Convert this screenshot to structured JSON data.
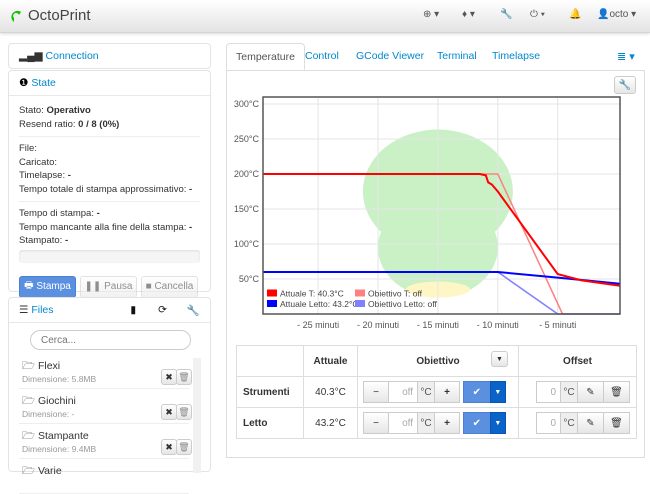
{
  "navbar": {
    "brand": "OctoPrint",
    "user": "octo"
  },
  "connection": {
    "title": "Connection"
  },
  "state": {
    "title": "State",
    "stato_label": "Stato:",
    "stato_value": "Operativo",
    "resend_label": "Resend ratio:",
    "resend_value": "0 / 8 (0%)",
    "file_label": "File:",
    "caricato_label": "Caricato:",
    "timelapse_label": "Timelapse:",
    "timelapse_value": "-",
    "tempo_totale_label": "Tempo totale di stampa approssimativo:",
    "tempo_totale_value": "-",
    "tempo_stampa_label": "Tempo di stampa:",
    "tempo_stampa_value": "-",
    "tempo_mancante_label": "Tempo mancante alla fine della stampa:",
    "tempo_mancante_value": "-",
    "stampato_label": "Stampato:",
    "stampato_value": "-",
    "progress": 0,
    "stampa_button": "Stampa",
    "pausa_button": "Pausa",
    "cancella_button": "Cancella"
  },
  "files": {
    "title": "Files",
    "search_placeholder": "Cerca...",
    "items": [
      {
        "name": "Flexi",
        "size": "Dimensione: 5.8MB"
      },
      {
        "name": "Giochini",
        "size": "Dimensione: -"
      },
      {
        "name": "Stampante",
        "size": "Dimensione: 9.4MB"
      },
      {
        "name": "Varie",
        "size": ""
      }
    ]
  },
  "tabs": [
    "Temperature",
    "Control",
    "GCode Viewer",
    "Terminal",
    "Timelapse"
  ],
  "chart_data": {
    "type": "line",
    "xlabel": "",
    "ylabel": "",
    "xlim": [
      -29.6,
      0.2
    ],
    "ylim": [
      0,
      310
    ],
    "xticks": [
      -25,
      -20,
      -15,
      -10,
      -5
    ],
    "xtick_labels": [
      "- 25 minuti",
      "- 20 minuti",
      "- 15 minuti",
      "- 10 minuti",
      "- 5 minuti"
    ],
    "yticks": [
      50,
      100,
      150,
      200,
      250,
      300
    ],
    "ytick_labels": [
      "50°C",
      "100°C",
      "150°C",
      "200°C",
      "250°C",
      "300°C"
    ],
    "legend_position": "bottom-left",
    "series": [
      {
        "name": "Attuale T: 40.3°C",
        "color": "#ff0000",
        "x": [
          -29.6,
          -11.5,
          -11,
          -10.8,
          -10.5,
          -10,
          -5,
          -3,
          0.2
        ],
        "y": [
          200,
          200,
          198,
          188,
          185,
          175,
          57,
          48,
          40.3
        ]
      },
      {
        "name": "Obiettivo T: off",
        "color": "#ff8080",
        "x": [
          -29.6,
          -10,
          -4.6,
          0.2
        ],
        "y": [
          200,
          200,
          0,
          0
        ]
      },
      {
        "name": "Attuale Letto: 43.2°C",
        "color": "#0000ff",
        "x": [
          -29.6,
          -10,
          -5,
          0.2
        ],
        "y": [
          60,
          60,
          52,
          43.2
        ]
      },
      {
        "name": "Obiettivo Letto: off",
        "color": "#8080ff",
        "x": [
          -29.6,
          -10,
          -5,
          0.2
        ],
        "y": [
          60,
          60,
          0,
          0
        ]
      }
    ]
  },
  "temp_table": {
    "headers": [
      "",
      "Attuale",
      "Obiettivo",
      "Offset"
    ],
    "rows": [
      {
        "name": "Strumenti",
        "actual": "40.3°C",
        "target": "off",
        "unit": "°C",
        "offset": "0"
      },
      {
        "name": "Letto",
        "actual": "43.2°C",
        "target": "off",
        "unit": "°C",
        "offset": "0"
      }
    ]
  }
}
